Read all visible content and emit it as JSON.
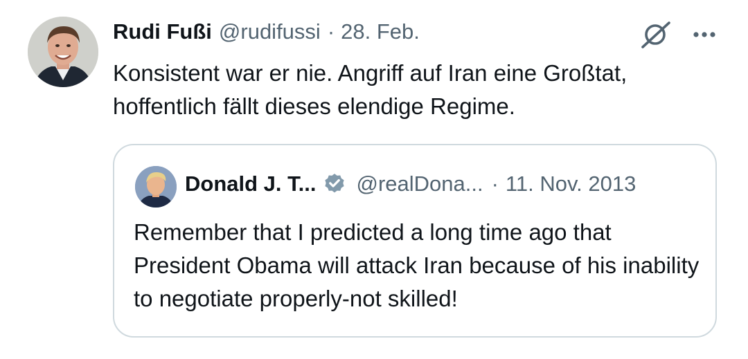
{
  "tweet": {
    "author_name": "Rudi Fußi",
    "author_handle": "@rudifussi",
    "separator": "·",
    "date": "28. Feb.",
    "text": "Konsistent war er nie. Angriff auf Iran eine Großtat, hoffentlich fällt dieses elendige Regime.",
    "actions": [
      "grok-icon",
      "more-icon"
    ]
  },
  "quoted_tweet": {
    "author_name": "Donald J. T...",
    "verified": true,
    "author_handle": "@realDona...",
    "separator": "·",
    "date": "11. Nov. 2013",
    "text": "Remember that I predicted a long time ago that President Obama will attack Iran because of his inability to negotiate properly-not skilled!"
  },
  "colors": {
    "text_primary": "#0f1419",
    "text_secondary": "#536471",
    "border": "#cfd9de",
    "verified_badge": "#829aab"
  }
}
